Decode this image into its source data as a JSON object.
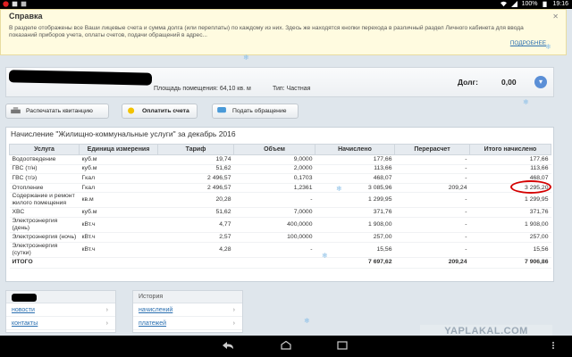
{
  "statusbar": {
    "time": "19:16",
    "battery": "100%"
  },
  "infobar": {
    "title": "Справка",
    "text": "В разделе отображены все Ваши лицевые счета и сумма долга (или переплаты) по каждому из них. Здесь же находятся кнопки перехода в различный раздел Личного кабинета для ввода показаний приборов учета, оплаты счетов, подачи обращений в адрес...",
    "more": "ПОДРОБНЕЕ"
  },
  "account": {
    "area": "Площадь помещения: 64,10 кв. м",
    "type": "Тип: Частная",
    "debt_label": "Долг:",
    "debt_value": "0,00"
  },
  "actions": {
    "print": "Распечатать квитанцию",
    "pay": "Оплатить счета",
    "appeal": "Подать обращение"
  },
  "table": {
    "title": "Начисление \"Жилищно-коммунальные услуги\" за декабрь 2016",
    "headers": [
      "Услуга",
      "Единица измерения",
      "Тариф",
      "Объем",
      "Начислено",
      "Перерасчет",
      "Итого начислено"
    ],
    "rows": [
      [
        "Водоотведение",
        "куб.м",
        "19,74",
        "9,0000",
        "177,66",
        "-",
        "177,66"
      ],
      [
        "ГВС (т/н)",
        "куб.м",
        "51,62",
        "2,0000",
        "113,66",
        "-",
        "113,66"
      ],
      [
        "ГВС (т/э)",
        "Гкал",
        "2 496,57",
        "0,1703",
        "468,07",
        "-",
        "468,07"
      ],
      [
        "Отопление",
        "Гкал",
        "2 496,57",
        "1,2361",
        "3 085,96",
        "209,24",
        "3 295,20"
      ],
      [
        "Содержание и ремонт жилого помещения",
        "кв.м",
        "20,28",
        "-",
        "1 299,95",
        "-",
        "1 299,95"
      ],
      [
        "ХВС",
        "куб.м",
        "51,62",
        "7,0000",
        "371,76",
        "-",
        "371,76"
      ],
      [
        "Электроэнергия (день)",
        "кВт.ч",
        "4,77",
        "400,0000",
        "1 908,00",
        "-",
        "1 908,00"
      ],
      [
        "Электроэнергия (ночь)",
        "кВт.ч",
        "2,57",
        "100,0000",
        "257,00",
        "-",
        "257,00"
      ],
      [
        "Электроэнергия (сутки)",
        "кВт.ч",
        "4,28",
        "-",
        "15,56",
        "-",
        "15,56"
      ]
    ],
    "total": [
      "ИТОГО",
      "",
      "",
      "",
      "7 697,62",
      "209,24",
      "7 906,86"
    ]
  },
  "panels": {
    "right_title": "История",
    "left_items": [
      "новости",
      "контакты"
    ],
    "right_items": [
      "начислений",
      "платежей"
    ]
  },
  "watermark": "YAPLAKAL.COM"
}
